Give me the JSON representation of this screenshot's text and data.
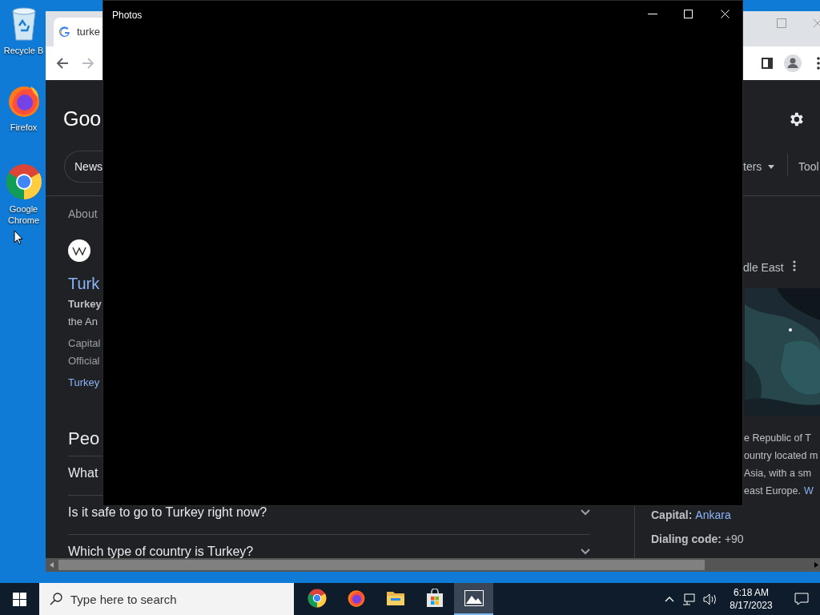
{
  "desktop": {
    "icons": [
      {
        "kind": "recycle-bin",
        "label": "Recycle B"
      },
      {
        "kind": "firefox",
        "label": "Firefox"
      },
      {
        "kind": "chrome",
        "label": "Google Chrome"
      }
    ]
  },
  "browser": {
    "tab": {
      "title": "turke"
    },
    "page": {
      "logo": "Goo",
      "chips": [
        "News"
      ],
      "filters": "ters",
      "tools": "Tool",
      "about": "About",
      "result": {
        "title": "Turk",
        "snippet_lines": [
          {
            "text": "Turkey",
            "bold": true
          },
          {
            "text": "the An",
            "bold": false
          }
        ],
        "facts": [
          "Capital",
          "Official"
        ],
        "link": "Turkey"
      },
      "people_also_ask": {
        "heading": "Peo",
        "questions": [
          {
            "text": "What"
          },
          {
            "text": "Is it safe to go to Turkey right now?"
          },
          {
            "text": "Which type of country is Turkey?"
          }
        ]
      },
      "panel": {
        "subtitle": "dle East",
        "description_lines": [
          "e Republic of T",
          "ountry located m",
          "Asia, with a sm",
          "east Europe."
        ],
        "more_link": "W",
        "facts": [
          {
            "kind": "link",
            "label": "Capital:",
            "value": "Ankara"
          },
          {
            "kind": "plain",
            "label": "Dialing code:",
            "value": "+90"
          }
        ]
      }
    }
  },
  "photos": {
    "title": "Photos"
  },
  "taskbar": {
    "search_placeholder": "Type here to search",
    "apps": [
      {
        "kind": "chrome",
        "selected": false
      },
      {
        "kind": "firefox",
        "selected": false
      },
      {
        "kind": "folder",
        "selected": false
      },
      {
        "kind": "store",
        "selected": false
      },
      {
        "kind": "photos",
        "selected": true
      }
    ],
    "time": "6:18 AM",
    "date": "8/17/2023"
  }
}
